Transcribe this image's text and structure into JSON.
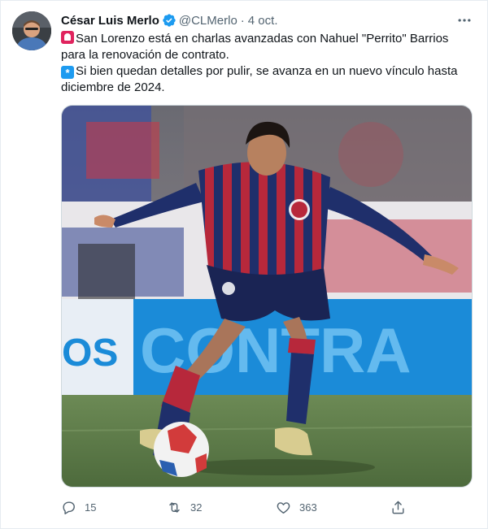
{
  "tweet": {
    "author_name": "César Luis Merlo",
    "handle": "@CLMerlo",
    "separator": "·",
    "timestamp": "4 oct.",
    "text_lines": [
      "San Lorenzo está en charlas avanzadas con Nahuel \"Perrito\" Barrios",
      "para la renovación de contrato.",
      "Si bien quedan detalles por pulir, se avanza en un nuevo vínculo hasta",
      "diciembre de 2024."
    ],
    "emojis": [
      "siren-emoji",
      "asterisk-emoji"
    ],
    "media": {
      "background_text": "CONTRA"
    },
    "counts": {
      "replies": "15",
      "retweets": "32",
      "likes": "363"
    }
  },
  "colors": {
    "verified": "#1d9bf0",
    "secondary_text": "#536471",
    "primary_text": "#0f1419",
    "jersey_red": "#b7283b",
    "jersey_blue": "#1f2f6b"
  },
  "icons": [
    "verified-badge-icon",
    "more-options-icon",
    "reply-icon",
    "retweet-icon",
    "like-icon",
    "share-icon"
  ]
}
